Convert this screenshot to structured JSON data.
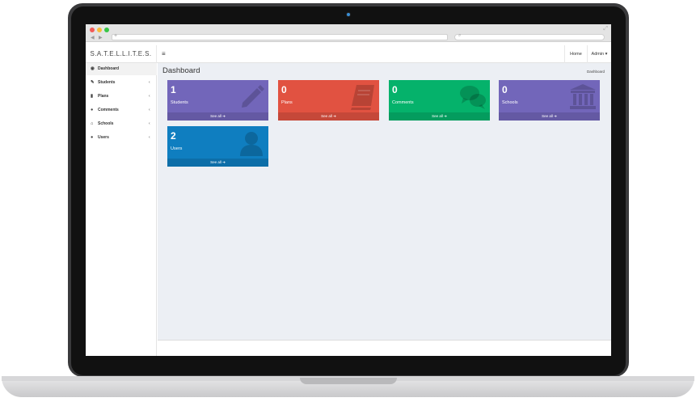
{
  "brand": "S.A.T.E.L.L.I.T.E.S.",
  "topnav": {
    "menu_icon": "bars-icon",
    "home": "Home",
    "admin": "Admin ▾"
  },
  "sidebar": {
    "items": [
      {
        "label": "Dashboard",
        "icon": "dashboard-icon",
        "active": true
      },
      {
        "label": "Students",
        "icon": "pencil-icon"
      },
      {
        "label": "Plans",
        "icon": "book-icon"
      },
      {
        "label": "Comments",
        "icon": "comments-icon"
      },
      {
        "label": "Schools",
        "icon": "institution-icon"
      },
      {
        "label": "Users",
        "icon": "user-icon"
      }
    ]
  },
  "page": {
    "title": "Dashboard",
    "breadcrumb": "Dashboard"
  },
  "stats": [
    {
      "count": "1",
      "label": "Students",
      "link": "See all",
      "color": "#7266ba",
      "icon": "pencil-icon"
    },
    {
      "count": "0",
      "label": "Plans",
      "link": "See all",
      "color": "#e15241",
      "icon": "book-icon"
    },
    {
      "count": "0",
      "label": "Comments",
      "link": "See all",
      "color": "#05b26b",
      "icon": "comments-icon"
    },
    {
      "count": "0",
      "label": "Schools",
      "link": "See all",
      "color": "#7266ba",
      "icon": "institution-icon"
    },
    {
      "count": "2",
      "label": "Users",
      "link": "See all",
      "color": "#0f7ec0",
      "icon": "user-icon"
    }
  ]
}
